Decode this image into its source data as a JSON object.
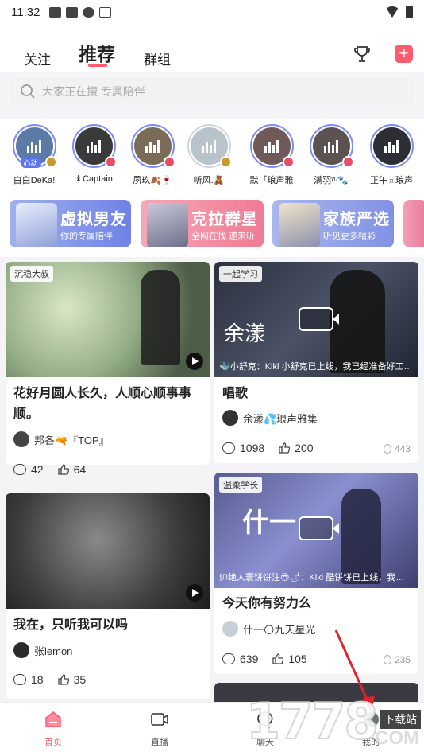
{
  "status_bar": {
    "time": "11:32"
  },
  "header": {
    "tabs": [
      {
        "label": "关注"
      },
      {
        "label": "推荐"
      },
      {
        "label": "群组"
      }
    ],
    "active_tab": "推荐",
    "accent_color": "#ff5a6e",
    "add_label": "+"
  },
  "search": {
    "placeholder": "大家正在搜 专属陪伴"
  },
  "avatars": [
    {
      "name": "白白DeKa!",
      "tag": "心动",
      "color": "#5b7aa8"
    },
    {
      "name": "♝Captain",
      "tag": "",
      "color": "#3a3a3a"
    },
    {
      "name": "夙玖🍂🍷",
      "tag": "",
      "color": "#7a6c58"
    },
    {
      "name": "听风.🧸",
      "tag": "",
      "color": "#b9c3cc"
    },
    {
      "name": "默「琅声雅",
      "tag": "",
      "color": "#6f5a59"
    },
    {
      "name": "满羽ᵞᵘ🐾",
      "tag": "",
      "color": "#5d5252"
    },
    {
      "name": "正午☼琅声",
      "tag": "",
      "color": "#2d2d36"
    }
  ],
  "banners": [
    {
      "title": "虚拟男友",
      "subtitle": "你的专属陪伴",
      "color": "#7d8fe8"
    },
    {
      "title": "克拉群星",
      "subtitle": "全网在找 速来听",
      "color": "#f07d97"
    },
    {
      "title": "家族严选",
      "subtitle": "听见更多精彩",
      "color": "#8c9ae6"
    }
  ],
  "feed": [
    {
      "tag": "沉稳大叔",
      "title": "花好月圆人长久，人顺心顺事事顺。",
      "author": "邦各🔫『TOP』",
      "comments": "42",
      "likes": "64"
    },
    {
      "tag": "一起学习",
      "caption": "🐳小舒克：Kiki 小舒克已上线，我已经准备好工…",
      "title": "唱歌",
      "author": "余漾💦琅声雅集",
      "comments": "1098",
      "likes": "200",
      "heat": "443"
    },
    {
      "tag": "",
      "title": "我在，只听我可以吗",
      "author": "张lemon",
      "comments": "18",
      "likes": "35"
    },
    {
      "tag": "温柔学长",
      "caption": "帅绝人寰饼饼注😎🌶：Kiki 酷饼饼已上线，我…",
      "title": "今天你有努力么",
      "author": "什一🌕九天星光",
      "comments": "639",
      "likes": "105",
      "heat": "235"
    }
  ],
  "bottom_nav": [
    {
      "label": "首页"
    },
    {
      "label": "直播"
    },
    {
      "label": "聊天"
    },
    {
      "label": "我的"
    }
  ],
  "watermark": {
    "digits": "1778",
    "box_text": "下载站",
    "suffix": "COM"
  }
}
